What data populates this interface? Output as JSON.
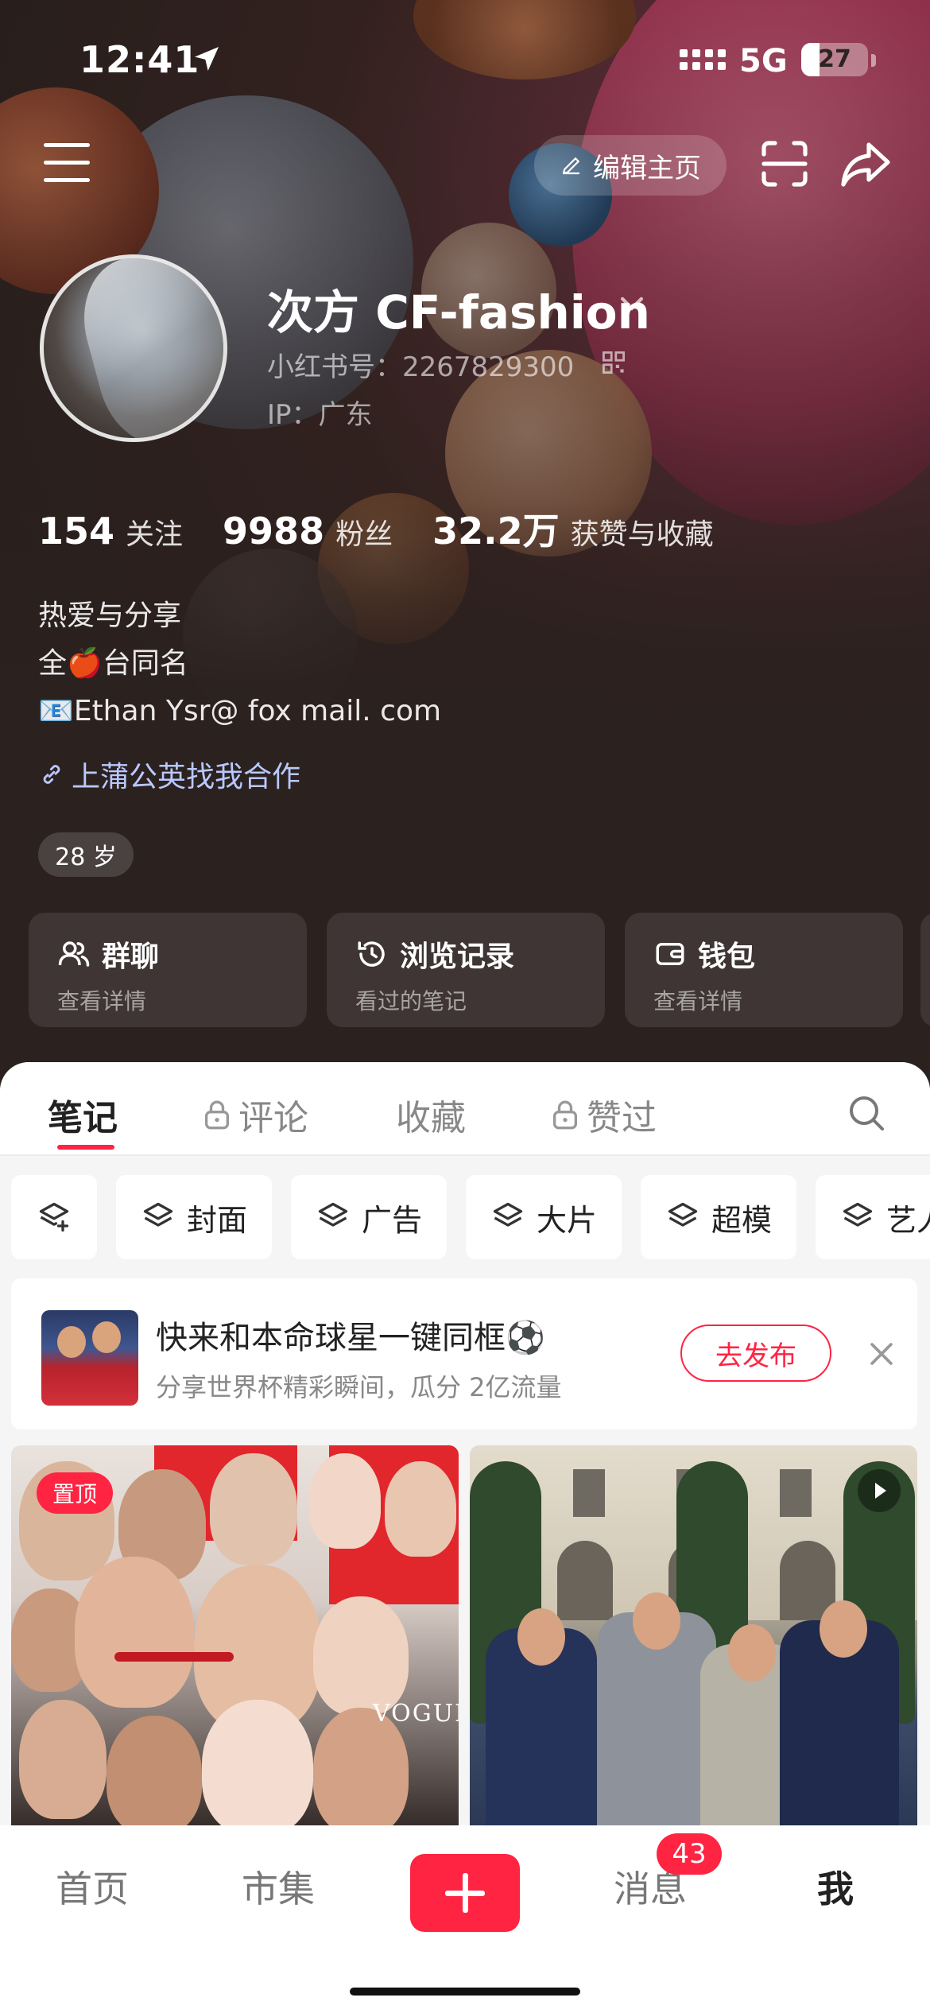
{
  "status_bar": {
    "time": "12:41",
    "network": "5G",
    "battery": "27",
    "battery_level": 0.27
  },
  "header": {
    "edit_label": "编辑主页",
    "icons": [
      "menu-icon",
      "pencil-icon",
      "scan-icon",
      "share-icon"
    ]
  },
  "profile": {
    "name": "次方 CF-fashion",
    "id_text": "小红书号：2267829300",
    "ip_text": "IP：广东",
    "stats": [
      {
        "num": "154",
        "label": "关注"
      },
      {
        "num": "9988",
        "label": "粉丝"
      },
      {
        "num": "32.2万",
        "label": "获赞与收藏"
      }
    ],
    "bio": [
      "热爱与分享",
      "全🍎台同名",
      "📧Ethan Ysr@ fox mail. com"
    ],
    "link_text": "上蒲公英找我合作",
    "age_tag": "28 岁"
  },
  "quick_cards": [
    {
      "title": "群聊",
      "sub": "查看详情",
      "icon": "group-icon"
    },
    {
      "title": "浏览记录",
      "sub": "看过的笔记",
      "icon": "clock-icon"
    },
    {
      "title": "钱包",
      "sub": "查看详情",
      "icon": "wallet-icon"
    }
  ],
  "tabs": [
    {
      "label": "笔记",
      "locked": false,
      "active": true
    },
    {
      "label": "评论",
      "locked": true,
      "active": false
    },
    {
      "label": "收藏",
      "locked": false,
      "active": false
    },
    {
      "label": "赞过",
      "locked": true,
      "active": false
    }
  ],
  "chips": [
    "封面",
    "广告",
    "大片",
    "超模",
    "艺人"
  ],
  "banner": {
    "title": "快来和本命球星一键同框⚽",
    "subtitle": "分享世界杯精彩瞬间，瓜分 2亿流量",
    "button": "去发布"
  },
  "feed": {
    "pin_label": "置顶",
    "vogue_text": "VOGUE"
  },
  "tabbar": {
    "items": [
      "首页",
      "市集",
      "消息",
      "我"
    ],
    "message_badge": "43",
    "active": "我"
  },
  "colors": {
    "accent": "#ff2442",
    "header_bg": "#2b2220",
    "link": "#b9c8ff"
  }
}
